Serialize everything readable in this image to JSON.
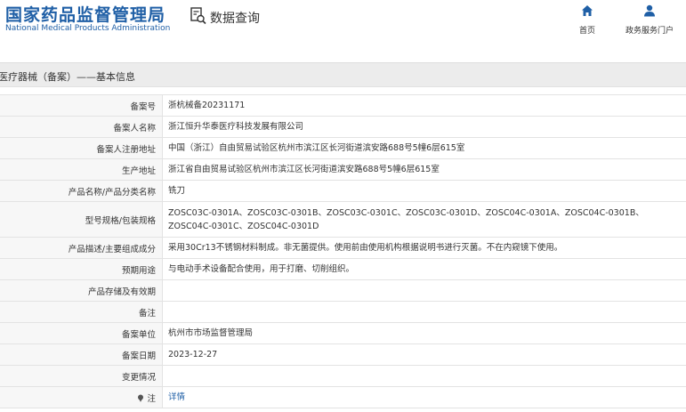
{
  "header": {
    "logo_cn": "国家药品监督管理局",
    "logo_en": "National Medical Products Administration",
    "query_label": "数据查询",
    "nav": [
      {
        "label": "首页",
        "icon": "home-icon"
      },
      {
        "label": "政务服务门户",
        "icon": "user-icon"
      }
    ]
  },
  "breadcrumb": "医疗器械（备案）——基本信息",
  "rows": [
    {
      "key": "备案号",
      "value": "浙杭械备20231171"
    },
    {
      "key": "备案人名称",
      "value": "浙江恒升华泰医疗科技发展有限公司"
    },
    {
      "key": "备案人注册地址",
      "value": "中国（浙江）自由贸易试验区杭州市滨江区长河街道滨安路688号5幢6层615室"
    },
    {
      "key": "生产地址",
      "value": "浙江省自由贸易试验区杭州市滨江区长河街道滨安路688号5幢6层615室"
    },
    {
      "key": "产品名称/产品分类名称",
      "value": "铣刀"
    },
    {
      "key": "型号规格/包装规格",
      "value": "ZOSC03C-0301A、ZOSC03C-0301B、ZOSC03C-0301C、ZOSC03C-0301D、ZOSC04C-0301A、ZOSC04C-0301B、ZOSC04C-0301C、ZOSC04C-0301D"
    },
    {
      "key": "产品描述/主要组成成分",
      "value": "采用30Cr13不锈钢材料制成。非无菌提供。使用前由使用机构根据说明书进行灭菌。不在内窥镜下使用。"
    },
    {
      "key": "预期用途",
      "value": "与电动手术设备配合使用，用于打磨、切削组织。"
    },
    {
      "key": "产品存储及有效期",
      "value": ""
    },
    {
      "key": "备注",
      "value": ""
    },
    {
      "key": "备案单位",
      "value": "杭州市市场监督管理局"
    },
    {
      "key": "备案日期",
      "value": "2023-12-27"
    },
    {
      "key": "变更情况",
      "value": ""
    }
  ],
  "note_row": {
    "key": "注",
    "link_text": "详情"
  }
}
